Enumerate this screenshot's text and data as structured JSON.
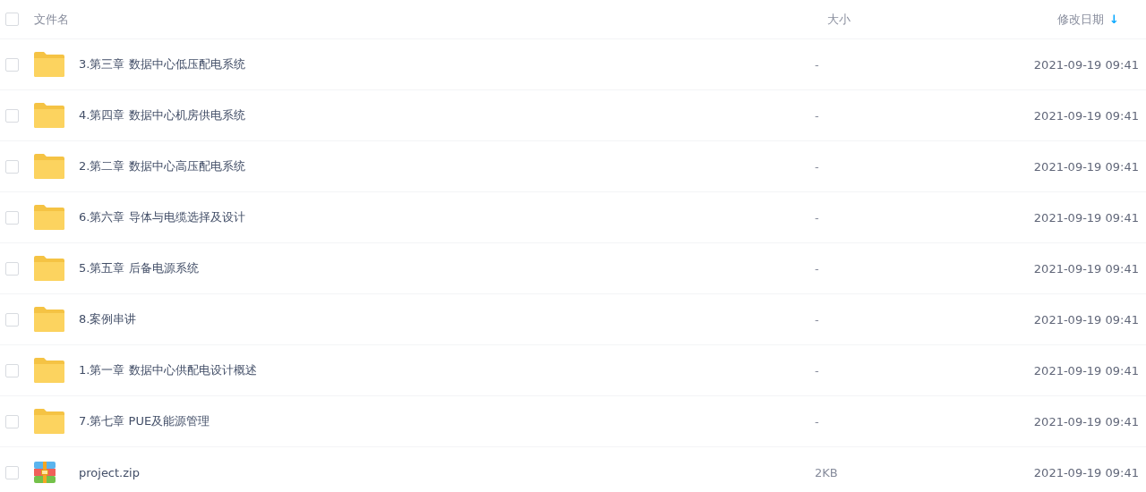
{
  "table": {
    "columns": [
      {
        "label": "文件名"
      },
      {
        "label": "大小"
      },
      {
        "label": "修改日期",
        "sort_icon": "↓"
      }
    ],
    "select_all": {
      "checked": false
    },
    "rows": [
      {
        "kind": "folder",
        "name": "3.第三章 数据中心低压配电系统",
        "size": "-",
        "modified": "2021-09-19 09:41",
        "checked": false
      },
      {
        "kind": "folder",
        "name": "4.第四章 数据中心机房供电系统",
        "size": "-",
        "modified": "2021-09-19 09:41",
        "checked": false
      },
      {
        "kind": "folder",
        "name": "2.第二章 数据中心高压配电系统",
        "size": "-",
        "modified": "2021-09-19 09:41",
        "checked": false
      },
      {
        "kind": "folder",
        "name": "6.第六章 导体与电缆选择及设计",
        "size": "-",
        "modified": "2021-09-19 09:41",
        "checked": false
      },
      {
        "kind": "folder",
        "name": "5.第五章 后备电源系统",
        "size": "-",
        "modified": "2021-09-19 09:41",
        "checked": false
      },
      {
        "kind": "folder",
        "name": "8.案例串讲",
        "size": "-",
        "modified": "2021-09-19 09:41",
        "checked": false
      },
      {
        "kind": "folder",
        "name": "1.第一章 数据中心供配电设计概述",
        "size": "-",
        "modified": "2021-09-19 09:41",
        "checked": false
      },
      {
        "kind": "folder",
        "name": "7.第七章 PUE及能源管理",
        "size": "-",
        "modified": "2021-09-19 09:41",
        "checked": false
      },
      {
        "kind": "zip",
        "name": "project.zip",
        "size": "2KB",
        "modified": "2021-09-19 09:41",
        "checked": false
      }
    ]
  }
}
